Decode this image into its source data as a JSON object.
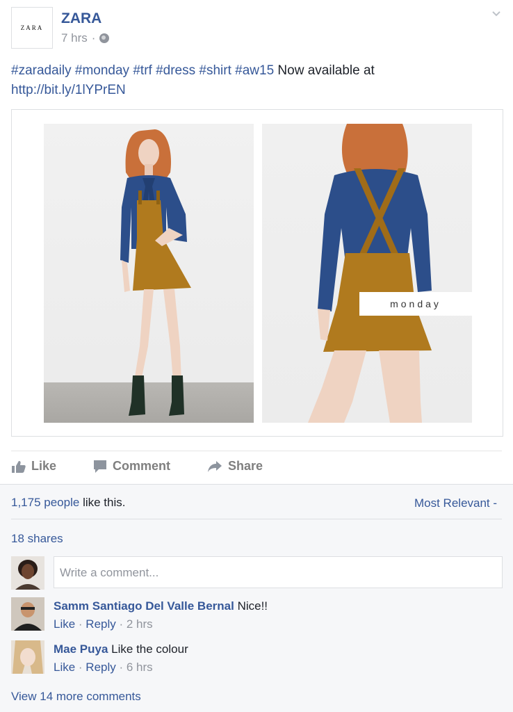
{
  "post": {
    "page_name": "ZARA",
    "avatar_text": "ZARA",
    "time": "7 hrs",
    "dot": "·",
    "hashtags": [
      "#zaradaily",
      "#monday",
      "#trf",
      "#dress",
      "#shirt",
      "#aw15"
    ],
    "text": "Now available at",
    "link": "http://bit.ly/1lYPrEN",
    "image_label": "monday"
  },
  "actions": {
    "like": "Like",
    "comment": "Comment",
    "share": "Share"
  },
  "stats": {
    "likes_count": "1,175 people",
    "likes_suffix": "like this.",
    "sort_label": "Most Relevant -",
    "shares": "18 shares"
  },
  "composer": {
    "placeholder": "Write a comment..."
  },
  "comments": [
    {
      "author": "Samm Santiago Del Valle Bernal",
      "text": "Nice!!",
      "like": "Like",
      "reply": "Reply",
      "time": "2 hrs"
    },
    {
      "author": "Mae Puya",
      "text": "Like the colour",
      "like": "Like",
      "reply": "Reply",
      "time": "6 hrs"
    }
  ],
  "view_more": "View 14 more comments",
  "colors": {
    "link": "#365899",
    "muted": "#90949c",
    "text": "#1d2129",
    "dress": "#b07a1e",
    "shirt": "#2c4e8a"
  }
}
